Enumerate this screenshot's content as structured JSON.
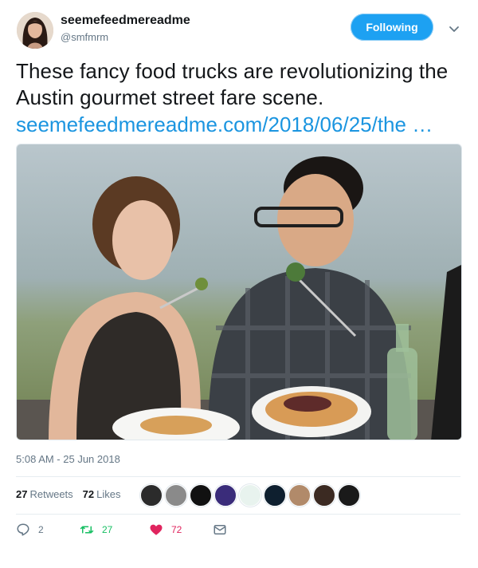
{
  "header": {
    "display_name": "seemefeedmereadme",
    "handle": "@smfmrm",
    "follow_label": "Following"
  },
  "tweet": {
    "text": "These fancy food trucks are revolutionizing the Austin gourmet street fare scene.",
    "link": "seemefeedmereadme.com/2018/06/25/the …"
  },
  "meta": {
    "timestamp": "5:08 AM - 25 Jun 2018"
  },
  "stats": {
    "retweets_count": "27",
    "retweets_label": "Retweets",
    "likes_count": "72",
    "likes_label": "Likes",
    "liker_avatar_colors": [
      "#2b2b2b",
      "#8a8a8a",
      "#111111",
      "#3a2c7a",
      "#e8f3ee",
      "#0e1f2f",
      "#b18a6a",
      "#3b2a22",
      "#1a1a1a"
    ]
  },
  "actions": {
    "reply_count": "2",
    "retweet_count": "27",
    "like_count": "72"
  },
  "colors": {
    "accent": "#1da1f2",
    "link": "#1b95e0",
    "retweet": "#17bf63",
    "like": "#e0245e",
    "muted": "#657786"
  }
}
